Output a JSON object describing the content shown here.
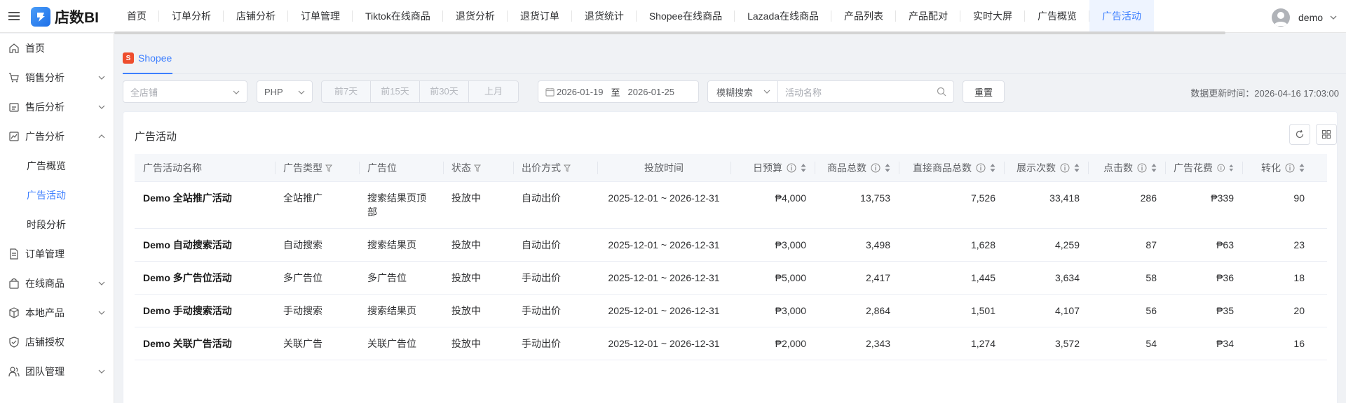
{
  "brand": {
    "name": "店数BI"
  },
  "nav": {
    "tabs": [
      {
        "label": "首页"
      },
      {
        "label": "订单分析"
      },
      {
        "label": "店铺分析"
      },
      {
        "label": "订单管理"
      },
      {
        "label": "Tiktok在线商品"
      },
      {
        "label": "退货分析"
      },
      {
        "label": "退货订单"
      },
      {
        "label": "退货统计"
      },
      {
        "label": "Shopee在线商品"
      },
      {
        "label": "Lazada在线商品"
      },
      {
        "label": "产品列表"
      },
      {
        "label": "产品配对"
      },
      {
        "label": "实时大屏"
      },
      {
        "label": "广告概览"
      },
      {
        "label": "广告活动"
      }
    ],
    "active_index": 14
  },
  "user": {
    "name": "demo"
  },
  "sidebar": {
    "items": [
      {
        "label": "首页",
        "icon": "home-icon"
      },
      {
        "label": "销售分析",
        "icon": "cart-icon"
      },
      {
        "label": "售后分析",
        "icon": "after-sales-icon"
      },
      {
        "label": "广告分析",
        "icon": "chart-icon"
      },
      {
        "label": "广告概览"
      },
      {
        "label": "广告活动"
      },
      {
        "label": "时段分析"
      },
      {
        "label": "订单管理",
        "icon": "document-icon"
      },
      {
        "label": "在线商品",
        "icon": "bag-icon"
      },
      {
        "label": "本地产品",
        "icon": "box-icon"
      },
      {
        "label": "店铺授权",
        "icon": "shield-icon"
      },
      {
        "label": "团队管理",
        "icon": "team-icon"
      }
    ]
  },
  "platform": {
    "label": "Shopee"
  },
  "filters": {
    "shop_placeholder": "全店铺",
    "currency": "PHP",
    "ranges": [
      "前7天",
      "前15天",
      "前30天",
      "上月"
    ],
    "date_start": "2026-01-19",
    "date_sep": "至",
    "date_end": "2026-01-25",
    "search_mode": "模糊搜索",
    "search_placeholder": "活动名称",
    "reset": "重置",
    "update_time": "数据更新时间：2026-04-16 17:03:00"
  },
  "card": {
    "title": "广告活动"
  },
  "table": {
    "headers": [
      "广告活动名称",
      "广告类型",
      "广告位",
      "状态",
      "出价方式",
      "投放时间",
      "日预算",
      "商品总数",
      "直接商品总数",
      "展示次数",
      "点击数",
      "广告花费",
      "转化"
    ],
    "rows": [
      [
        "Demo 全站推广活动",
        "全站推广",
        "搜索结果页顶部",
        "投放中",
        "自动出价",
        "2025-12-01 ~ 2026-12-31",
        "₱4,000",
        "13,753",
        "7,526",
        "33,418",
        "286",
        "₱339",
        "90"
      ],
      [
        "Demo 自动搜索活动",
        "自动搜索",
        "搜索结果页",
        "投放中",
        "自动出价",
        "2025-12-01 ~ 2026-12-31",
        "₱3,000",
        "3,498",
        "1,628",
        "4,259",
        "87",
        "₱63",
        "23"
      ],
      [
        "Demo 多广告位活动",
        "多广告位",
        "多广告位",
        "投放中",
        "手动出价",
        "2025-12-01 ~ 2026-12-31",
        "₱5,000",
        "2,417",
        "1,445",
        "3,634",
        "58",
        "₱36",
        "18"
      ],
      [
        "Demo 手动搜索活动",
        "手动搜索",
        "搜索结果页",
        "投放中",
        "手动出价",
        "2025-12-01 ~ 2026-12-31",
        "₱3,000",
        "2,864",
        "1,501",
        "4,107",
        "56",
        "₱35",
        "20"
      ],
      [
        "Demo 关联广告活动",
        "关联广告",
        "关联广告位",
        "投放中",
        "手动出价",
        "2025-12-01 ~ 2026-12-31",
        "₱2,000",
        "2,343",
        "1,274",
        "3,572",
        "54",
        "₱34",
        "16"
      ]
    ]
  }
}
